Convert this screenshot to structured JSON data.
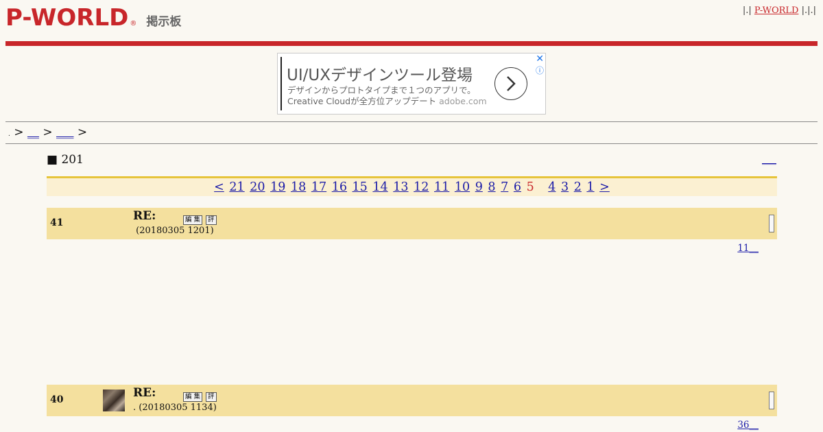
{
  "header": {
    "logo": "P-WORLD",
    "logo_reg": "®",
    "logo_subtitle": "掲示板",
    "top_links_prefix": "|.|",
    "top_link": "P-WORLD",
    "top_links_suffix": "|.|.|"
  },
  "ad": {
    "title": "UI/UXデザインツール登場",
    "description": "デザインからプロトタイプまで１つのアプリで。",
    "description2": "Creative Cloudが全方位アップデート",
    "domain": "adobe.com",
    "close_icon": "✕",
    "info_icon": "ⓘ"
  },
  "breadcrumb": {
    "home": ".",
    "sep": ">",
    "link1": "__",
    "link2": "___"
  },
  "thread": {
    "title": "■ 201",
    "link": "___"
  },
  "pager": {
    "prev": "<",
    "pages_before": [
      "21",
      "20",
      "19",
      "18",
      "17",
      "16",
      "15",
      "14",
      "13",
      "12",
      "11",
      "10",
      "9",
      "8",
      "7",
      "6"
    ],
    "current": "5",
    "pages_after": [
      "4",
      "3",
      "2",
      "1"
    ],
    "next": ">"
  },
  "posts": [
    {
      "number": "41",
      "subject": "RE:",
      "edit_label": "編 集",
      "rate_label": "評",
      "meta": " (20180305 1201)",
      "count_link": "11__",
      "has_avatar": false
    },
    {
      "number": "40",
      "subject": "RE:",
      "edit_label": "編 集",
      "rate_label": "評",
      "meta": ". (20180305 1134)",
      "count_link": "36__",
      "has_avatar": true
    }
  ],
  "colors": {
    "brand_red": "#c8262a",
    "post_bg": "#f4e09e",
    "pager_bg": "#fbf0d2",
    "pager_border": "#e6c43a"
  }
}
